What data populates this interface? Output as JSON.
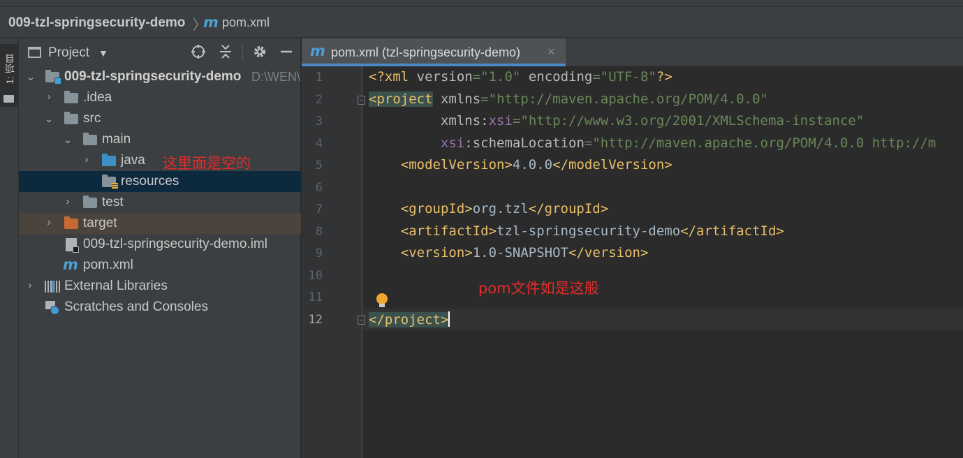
{
  "breadcrumb": {
    "project": "009-tzl-springsecurity-demo",
    "separator": "〉",
    "file_icon": "m",
    "file": "pom.xml"
  },
  "toolstrip": {
    "project_tab": "1: 项目"
  },
  "project_panel": {
    "title": "Project",
    "caret": "▼",
    "buttons": [
      "locate-icon",
      "collapse-all-icon",
      "gear-icon",
      "minimize-icon"
    ],
    "tree": [
      {
        "label": "009-tzl-springsecurity-demo",
        "path": "D:\\WEN\\",
        "expanded": true
      },
      {
        "label": ".idea",
        "expanded": false
      },
      {
        "label": "src",
        "expanded": true
      },
      {
        "label": "main",
        "expanded": true
      },
      {
        "label": "java",
        "expanded": false
      },
      {
        "label": "resources",
        "selected": true
      },
      {
        "label": "test",
        "expanded": false
      },
      {
        "label": "target",
        "expanded": false
      },
      {
        "label": "009-tzl-springsecurity-demo.iml"
      },
      {
        "label": "pom.xml",
        "icon_glyph": "m"
      },
      {
        "label": "External Libraries",
        "expanded": false
      },
      {
        "label": "Scratches and Consoles"
      }
    ],
    "annotation": "这里面是空的"
  },
  "editor": {
    "tab": {
      "icon_glyph": "m",
      "label": "pom.xml (tzl-springsecurity-demo)",
      "close": "×"
    },
    "line_numbers": [
      "1",
      "2",
      "3",
      "4",
      "5",
      "6",
      "7",
      "8",
      "9",
      "10",
      "11",
      "12"
    ],
    "current_line": "12",
    "lines": {
      "l1": {
        "pi_open": "<?xml ",
        "a1": "version",
        "eq1": "=",
        "s1": "\"1.0\"",
        "sp": " ",
        "a2": "encoding",
        "eq2": "=",
        "s2": "\"UTF-8\"",
        "pi_close": "?>"
      },
      "l2": {
        "tag": "<project",
        "sp": " ",
        "attr": "xmlns",
        "eq": "=",
        "str": "\"http://maven.apache.org/POM/4.0.0\""
      },
      "l3": {
        "indent": "         ",
        "attr": "xmlns",
        "colon": ":",
        "ns": "xsi",
        "eq": "=",
        "str": "\"http://www.w3.org/2001/XMLSchema-instance\""
      },
      "l4": {
        "indent": "         ",
        "ns": "xsi",
        "colon": ":",
        "attr": "schemaLocation",
        "eq": "=",
        "str": "\"http://maven.apache.org/POM/4.0.0 http://m"
      },
      "l5": {
        "indent": "    ",
        "open": "<modelVersion>",
        "text": "4.0.0",
        "close": "</modelVersion>"
      },
      "l7": {
        "indent": "    ",
        "open": "<groupId>",
        "text": "org.tzl",
        "close": "</groupId>"
      },
      "l8": {
        "indent": "    ",
        "open": "<artifactId>",
        "text": "tzl-springsecurity-demo",
        "close": "</artifactId>"
      },
      "l9": {
        "indent": "    ",
        "open": "<version>",
        "text": "1.0-SNAPSHOT",
        "close": "</version>"
      },
      "l12": {
        "tag": "</project>"
      }
    },
    "annotation": "pom文件如是这般"
  },
  "colors": {
    "accent": "#4a88c7",
    "annotation_red": "#e52b2b",
    "xml_tag": "#e8bf6a",
    "xml_string": "#6a8759",
    "xml_namespace": "#9876aa",
    "selection": "#0d293e",
    "excluded_bg": "#4b443c"
  }
}
